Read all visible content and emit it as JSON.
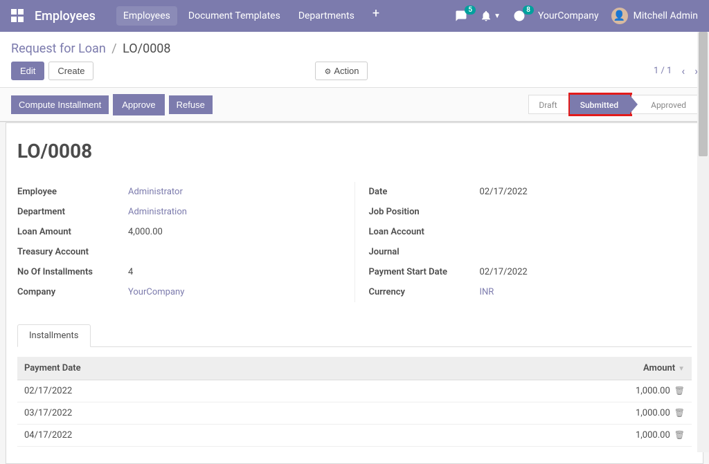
{
  "navbar": {
    "app_title": "Employees",
    "tabs": [
      {
        "label": "Employees",
        "active": true
      },
      {
        "label": "Document Templates",
        "active": false
      },
      {
        "label": "Departments",
        "active": false
      }
    ],
    "messages_badge": "5",
    "activities_badge": "8",
    "company_name": "YourCompany",
    "user_name": "Mitchell Admin"
  },
  "breadcrumb": {
    "parent": "Request for Loan",
    "current": "LO/0008"
  },
  "controls": {
    "edit_label": "Edit",
    "create_label": "Create",
    "action_label": "Action",
    "pager": "1 / 1"
  },
  "statusbar": {
    "buttons": {
      "compute": "Compute Installment",
      "approve": "Approve",
      "refuse": "Refuse"
    },
    "steps": {
      "draft": "Draft",
      "submitted": "Submitted",
      "approved": "Approved"
    }
  },
  "record": {
    "name": "LO/0008",
    "employee_label": "Employee",
    "employee_value": "Administrator",
    "department_label": "Department",
    "department_value": "Administration",
    "loan_amount_label": "Loan Amount",
    "loan_amount_value": "4,000.00",
    "treasury_account_label": "Treasury Account",
    "treasury_account_value": "",
    "no_installments_label": "No Of Installments",
    "no_installments_value": "4",
    "company_label": "Company",
    "company_value": "YourCompany",
    "date_label": "Date",
    "date_value": "02/17/2022",
    "job_position_label": "Job Position",
    "job_position_value": "",
    "loan_account_label": "Loan Account",
    "loan_account_value": "",
    "journal_label": "Journal",
    "journal_value": "",
    "payment_start_date_label": "Payment Start Date",
    "payment_start_date_value": "02/17/2022",
    "currency_label": "Currency",
    "currency_value": "INR"
  },
  "installments": {
    "tab_label": "Installments",
    "col_payment_date": "Payment Date",
    "col_amount": "Amount",
    "rows": [
      {
        "date": "02/17/2022",
        "amount": "1,000.00"
      },
      {
        "date": "03/17/2022",
        "amount": "1,000.00"
      },
      {
        "date": "04/17/2022",
        "amount": "1,000.00"
      }
    ]
  }
}
